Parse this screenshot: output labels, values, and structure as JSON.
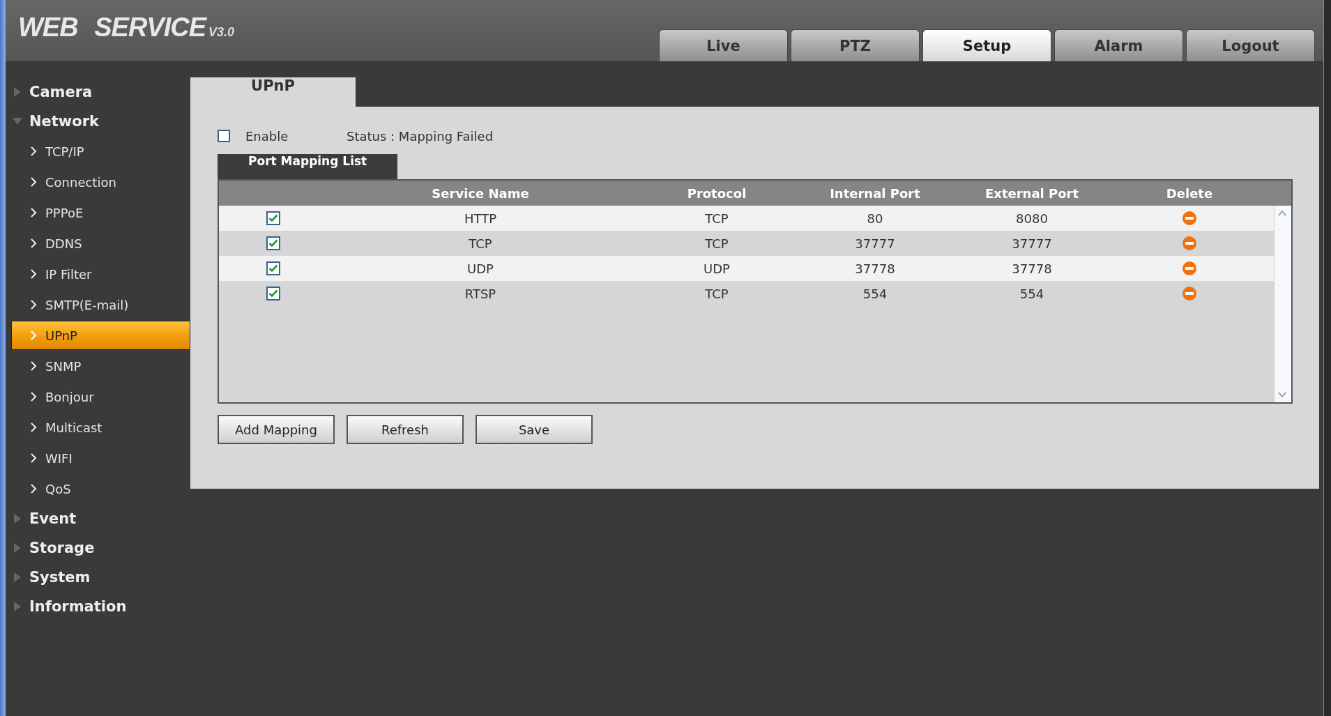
{
  "header": {
    "logo": {
      "title": "WEB SERVICE",
      "version": "V3.0"
    },
    "nav_tabs": [
      {
        "label": "Live",
        "selected": false
      },
      {
        "label": "PTZ",
        "selected": false
      },
      {
        "label": "Setup",
        "selected": true
      },
      {
        "label": "Alarm",
        "selected": false
      },
      {
        "label": "Logout",
        "selected": false
      }
    ]
  },
  "sidebar": {
    "sections": [
      {
        "label": "Camera",
        "expanded": false
      },
      {
        "label": "Network",
        "expanded": true,
        "children": [
          {
            "label": "TCP/IP",
            "selected": false
          },
          {
            "label": "Connection",
            "selected": false
          },
          {
            "label": "PPPoE",
            "selected": false
          },
          {
            "label": "DDNS",
            "selected": false
          },
          {
            "label": "IP Filter",
            "selected": false
          },
          {
            "label": "SMTP(E-mail)",
            "selected": false
          },
          {
            "label": "UPnP",
            "selected": true
          },
          {
            "label": "SNMP",
            "selected": false
          },
          {
            "label": "Bonjour",
            "selected": false
          },
          {
            "label": "Multicast",
            "selected": false
          },
          {
            "label": "WIFI",
            "selected": false
          },
          {
            "label": "QoS",
            "selected": false
          }
        ]
      },
      {
        "label": "Event",
        "expanded": false
      },
      {
        "label": "Storage",
        "expanded": false
      },
      {
        "label": "System",
        "expanded": false
      },
      {
        "label": "Information",
        "expanded": false
      }
    ]
  },
  "content": {
    "tab": "UPnP",
    "enable": {
      "label": "Enable",
      "checked": false
    },
    "status": "Status : Mapping Failed",
    "list_tab": "Port Mapping List",
    "table": {
      "columns": [
        "Service Name",
        "Protocol",
        "Internal Port",
        "External Port",
        "Delete"
      ],
      "rows": [
        {
          "checked": true,
          "service_name": "HTTP",
          "protocol": "TCP",
          "internal_port": "80",
          "external_port": "8080"
        },
        {
          "checked": true,
          "service_name": "TCP",
          "protocol": "TCP",
          "internal_port": "37777",
          "external_port": "37777"
        },
        {
          "checked": true,
          "service_name": "UDP",
          "protocol": "UDP",
          "internal_port": "37778",
          "external_port": "37778"
        },
        {
          "checked": true,
          "service_name": "RTSP",
          "protocol": "TCP",
          "internal_port": "554",
          "external_port": "554"
        }
      ]
    },
    "buttons": [
      "Add Mapping",
      "Refresh",
      "Save"
    ]
  }
}
